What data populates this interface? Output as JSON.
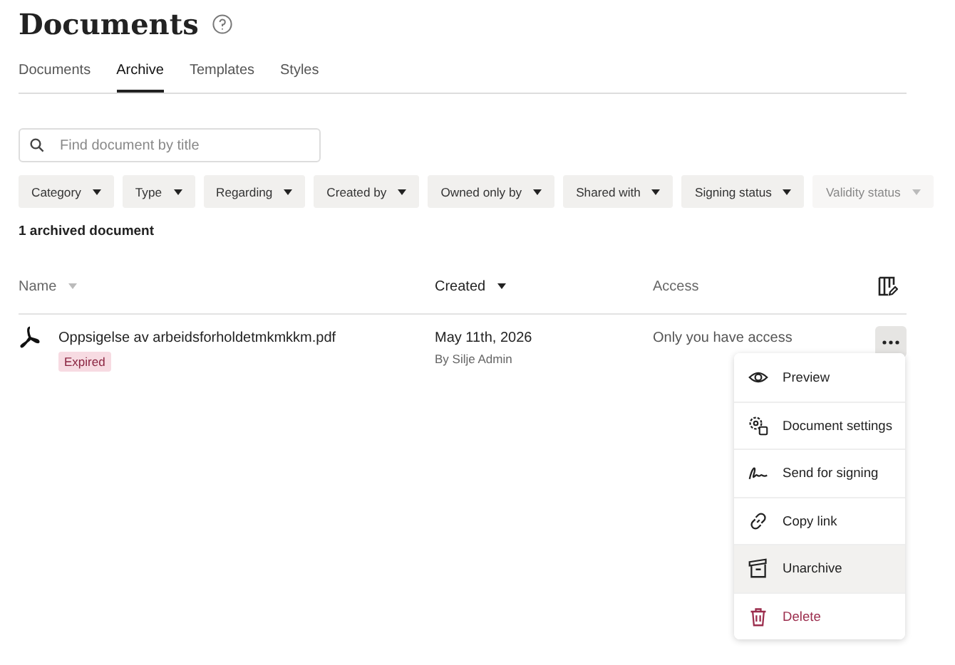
{
  "page": {
    "title": "Documents"
  },
  "tabs": [
    {
      "label": "Documents",
      "selected": false
    },
    {
      "label": "Archive",
      "selected": true
    },
    {
      "label": "Templates",
      "selected": false
    },
    {
      "label": "Styles",
      "selected": false
    }
  ],
  "search": {
    "placeholder": "Find document by title"
  },
  "filters": [
    {
      "label": "Category",
      "faded": false
    },
    {
      "label": "Type",
      "faded": false
    },
    {
      "label": "Regarding",
      "faded": false
    },
    {
      "label": "Created by",
      "faded": false
    },
    {
      "label": "Owned only by",
      "faded": false
    },
    {
      "label": "Shared with",
      "faded": false
    },
    {
      "label": "Signing status",
      "faded": false
    },
    {
      "label": "Validity status",
      "faded": true
    }
  ],
  "result_count": "1 archived document",
  "table": {
    "columns": [
      {
        "label": "Name",
        "sorted": false
      },
      {
        "label": "Created",
        "sorted": true
      },
      {
        "label": "Access",
        "sorted": false
      }
    ],
    "rows": [
      {
        "name": "Oppsigelse av arbeidsforholdetmkmkkm.pdf",
        "status": "Expired",
        "created": "May 11th, 2026",
        "created_by": "By Silje Admin",
        "access": "Only you have access",
        "menu_expanded": true
      }
    ]
  },
  "menu": [
    {
      "label": "Preview",
      "kind": "normal",
      "selected": false
    },
    {
      "label": "Document settings",
      "kind": "normal",
      "selected": false
    },
    {
      "label": "Send for signing",
      "kind": "normal",
      "selected": false
    },
    {
      "label": "Copy link",
      "kind": "normal",
      "selected": false
    },
    {
      "label": "Unarchive",
      "kind": "normal",
      "selected": true
    },
    {
      "label": "Delete",
      "kind": "danger",
      "selected": false
    }
  ]
}
